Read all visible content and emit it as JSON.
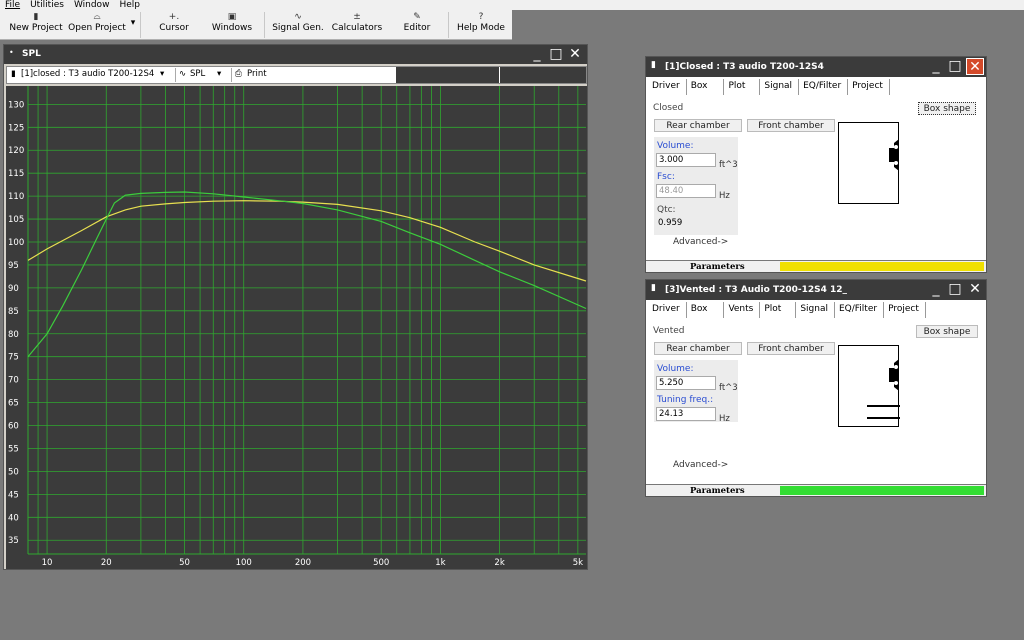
{
  "menu": [
    "File",
    "Utilities",
    "Window",
    "Help"
  ],
  "toolbar": [
    {
      "label": "New Project",
      "icon": "new-project-icon",
      "glyph": "▮"
    },
    {
      "label": "Open Project",
      "icon": "open-folder-icon",
      "glyph": "⌓"
    },
    {
      "label": "Cursor",
      "icon": "cursor-icon",
      "glyph": "+."
    },
    {
      "label": "Windows",
      "icon": "windows-icon",
      "glyph": "▣"
    },
    {
      "label": "Signal Gen.",
      "icon": "signal-gen-icon",
      "glyph": "∿"
    },
    {
      "label": "Calculators",
      "icon": "calculator-icon",
      "glyph": "±"
    },
    {
      "label": "Editor",
      "icon": "editor-icon",
      "glyph": "✎"
    },
    {
      "label": "Help Mode",
      "icon": "help-icon",
      "glyph": "?"
    }
  ],
  "spl": {
    "title": "SPL",
    "project_select": "[1]closed : T3 audio T200-12S4",
    "graph_select": "SPL",
    "print_label": "Print"
  },
  "chart_data": {
    "type": "line",
    "xscale": "log",
    "xlim": [
      8,
      5500
    ],
    "ylim": [
      32,
      134
    ],
    "x_ticks": [
      10,
      20,
      50,
      100,
      200,
      500,
      1000,
      2000,
      5000
    ],
    "x_tick_labels": [
      "10",
      "20",
      "50",
      "100",
      "200",
      "500",
      "1k",
      "2k",
      "5k"
    ],
    "y_ticks": [
      35,
      40,
      45,
      50,
      55,
      60,
      65,
      70,
      75,
      80,
      85,
      90,
      95,
      100,
      105,
      110,
      115,
      120,
      125,
      130
    ],
    "grid": true,
    "series": [
      {
        "color": "#e8e050",
        "x": [
          8,
          10,
          15,
          20,
          25,
          30,
          40,
          50,
          70,
          100,
          150,
          200,
          300,
          500,
          700,
          1000,
          1500,
          2000,
          3000,
          5500
        ],
        "y": [
          96,
          98.5,
          102.5,
          105.5,
          107,
          107.8,
          108.3,
          108.6,
          108.9,
          109,
          108.9,
          108.7,
          108.2,
          106.8,
          105.3,
          103.2,
          100,
          98,
          95,
          91.5
        ]
      },
      {
        "color": "#3ccc3c",
        "x": [
          8,
          10,
          12,
          15,
          18,
          20,
          22,
          25,
          30,
          40,
          50,
          70,
          100,
          150,
          200,
          300,
          500,
          700,
          1000,
          1500,
          2000,
          3000,
          5500
        ],
        "y": [
          75,
          80,
          86,
          94,
          101,
          105,
          108.5,
          110.2,
          110.6,
          110.8,
          110.9,
          110.5,
          109.8,
          109,
          108.4,
          107,
          104.5,
          102,
          99.5,
          96,
          93.5,
          90.5,
          85.5
        ]
      }
    ]
  },
  "closed": {
    "title": "[1]Closed : T3 audio T200-12S4",
    "tabs": [
      "Driver",
      "Box",
      "Plot",
      "Signal",
      "EQ/Filter",
      "Project"
    ],
    "box_type": "Closed",
    "box_shape": "Box shape",
    "rear_chamber": "Rear chamber",
    "front_chamber": "Front chamber",
    "volume_label": "Volume:",
    "volume_value": "3.000",
    "volume_unit": "ft^3",
    "fsc_label": "Fsc:",
    "fsc_value": "48.40",
    "fsc_unit": "Hz",
    "qtc_label": "Qtc:",
    "qtc_value": "0.959",
    "advanced": "Advanced->",
    "status_label": "Parameters",
    "status_color": "#f0e000"
  },
  "vented": {
    "title": "[3]Vented : T3 Audio T200-12S4 12_",
    "tabs": [
      "Driver",
      "Box",
      "Vents",
      "Plot",
      "Signal",
      "EQ/Filter",
      "Project"
    ],
    "box_type": "Vented",
    "box_shape": "Box shape",
    "rear_chamber": "Rear chamber",
    "front_chamber": "Front chamber",
    "volume_label": "Volume:",
    "volume_value": "5.250",
    "volume_unit": "ft^3",
    "tuning_label": "Tuning freq.:",
    "tuning_value": "24.13",
    "tuning_unit": "Hz",
    "advanced": "Advanced->",
    "status_label": "Parameters",
    "status_color": "#33dd33"
  }
}
